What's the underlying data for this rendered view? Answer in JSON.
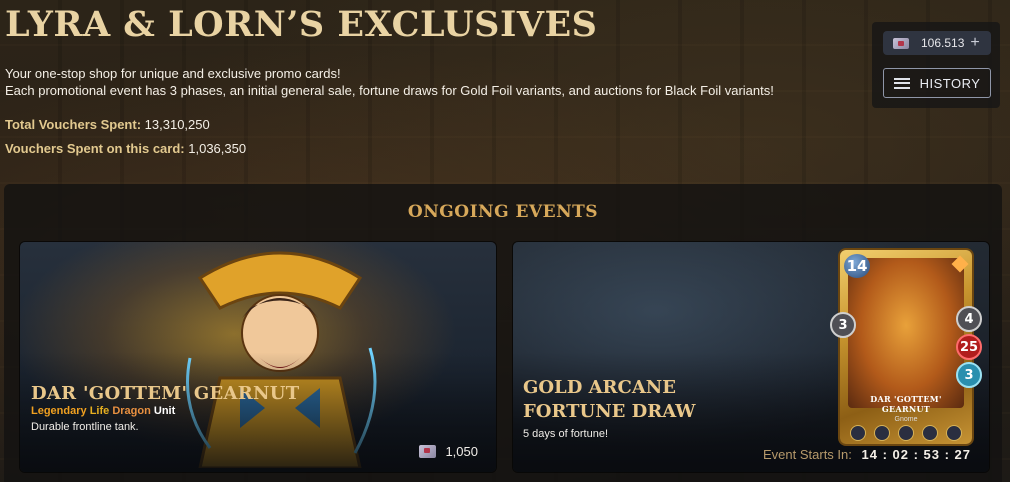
{
  "page": {
    "title": "LYRA & LORN’S EXCLUSIVES",
    "intro_line1": "Your one-stop shop for unique and exclusive promo cards!",
    "intro_line2": "Each promotional event has 3 phases, an initial general sale, fortune draws for Gold Foil variants, and auctions for Black Foil variants!",
    "stats": {
      "total_label": "Total Vouchers Spent:",
      "total_value": "13,310,250",
      "card_label": "Vouchers Spent on this card:",
      "card_value": "1,036,350"
    }
  },
  "topbar": {
    "balance": "106.513",
    "plus": "+",
    "history_label": "HISTORY",
    "icons": {
      "voucher": "voucher-icon",
      "history": "list-icon",
      "add": "plus-icon"
    }
  },
  "events": {
    "heading": "ONGOING EVENTS",
    "sale_card": {
      "name": "DAR 'GOTTEM' GEARNUT",
      "rarity": "Legendary",
      "element": "Life",
      "role": "Dragon",
      "unit": "Unit",
      "description": "Durable frontline tank.",
      "price": "1,050"
    },
    "fortune_card": {
      "title": "GOLD ARCANE FORTUNE DRAW",
      "description": "5 days of fortune!",
      "countdown_label": "Event Starts In:",
      "countdown_value": "14 : 02 : 53 : 27"
    },
    "promo_card": {
      "mana": "14",
      "melee": "3",
      "armor": "4",
      "health": "25",
      "speed": "3",
      "name": "DAR 'GOTTEM' GEARNUT",
      "race": "Gnome"
    }
  },
  "colors": {
    "title": "#e9d3a3",
    "heading": "#d7a85a",
    "rarity": "#f0a020",
    "card_name": "#e9c78a"
  }
}
